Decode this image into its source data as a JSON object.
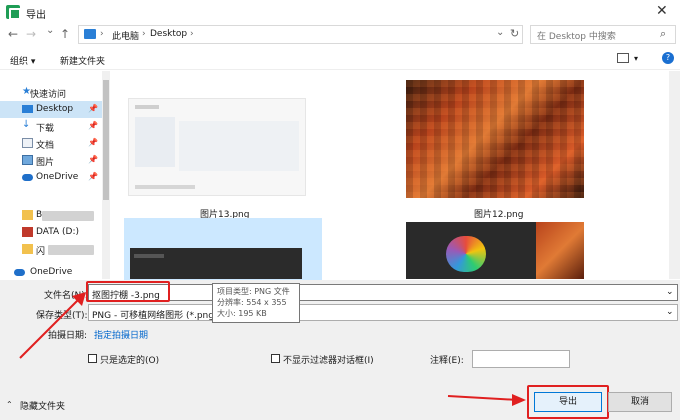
{
  "window": {
    "title": "导出",
    "close": "✕"
  },
  "nav": {
    "back": "←",
    "forward": "→",
    "dropdown": "⌄",
    "up": "↑",
    "breadcrumb": [
      "此电脑",
      "Desktop"
    ],
    "sep": "›",
    "refresh": "↻",
    "search_placeholder": "在 Desktop 中搜索"
  },
  "toolbar": {
    "organize": "组织 ▾",
    "new_folder": "新建文件夹",
    "help": "?"
  },
  "sidebar": {
    "items": [
      {
        "label": "快速访问"
      },
      {
        "label": "Desktop"
      },
      {
        "label": "下载"
      },
      {
        "label": "文档"
      },
      {
        "label": "图片"
      },
      {
        "label": "OneDrive"
      },
      {
        "label": "B"
      },
      {
        "label": "DATA (D:)"
      },
      {
        "label": "闪"
      },
      {
        "label": "OneDrive"
      }
    ]
  },
  "files": [
    {
      "name": "图片13.png"
    },
    {
      "name": "图片12.png"
    }
  ],
  "form": {
    "filename_label": "文件名(N):",
    "filename_value": "抠图拧棚 -3.png",
    "savetype_label": "保存类型(T):",
    "savetype_value": "PNG - 可移植网络图形 (*.png)",
    "date_label": "拍摄日期:",
    "date_link": "指定拍摄日期",
    "only_selected": "只是选定的(O)",
    "no_filter_dialog": "不显示过滤器对话框(I)",
    "note_label": "注释(E):",
    "note_value": ""
  },
  "tooltip": {
    "line1": "项目类型: PNG 文件",
    "line2": "分辨率: 554 x 355",
    "line3": "大小: 195 KB"
  },
  "buttons": {
    "hide_folders": "隐藏文件夹",
    "export": "导出",
    "cancel": "取消"
  },
  "colors": {
    "accent": "#0078d7",
    "highlight": "#e02020",
    "selection": "#cce8ff"
  }
}
